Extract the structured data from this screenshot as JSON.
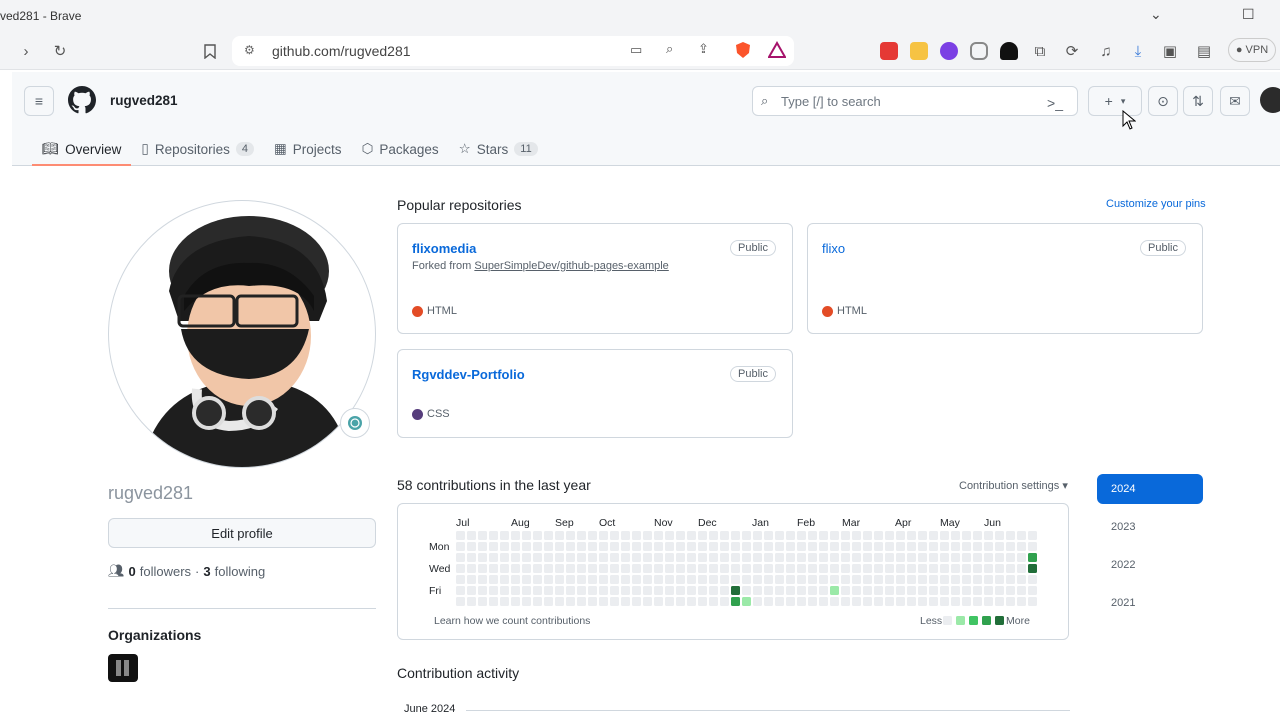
{
  "browser": {
    "title": "ved281 - Brave",
    "url": "github.com/rugved281",
    "vpn_label": "VPN"
  },
  "header": {
    "username": "rugved281",
    "search_placeholder": "Type [/] to search",
    "plus": "+",
    "hamburger": "≡"
  },
  "tabs": [
    {
      "label": "Overview",
      "count": ""
    },
    {
      "label": "Repositories",
      "count": "4"
    },
    {
      "label": "Projects",
      "count": ""
    },
    {
      "label": "Packages",
      "count": ""
    },
    {
      "label": "Stars",
      "count": "11"
    }
  ],
  "profile": {
    "username": "rugved281",
    "edit_label": "Edit profile",
    "followers_count": "0",
    "followers_label": "followers",
    "separator": "·",
    "following_count": "3",
    "following_label": "following",
    "orgs_heading": "Organizations"
  },
  "popular": {
    "heading": "Popular repositories",
    "customize": "Customize your pins",
    "repos": [
      {
        "name": "flixomedia",
        "badge": "Public",
        "forked_prefix": "Forked from",
        "forked_from": "SuperSimpleDev/github-pages-example",
        "language": "HTML",
        "lang_color": "#e34c26"
      },
      {
        "name": "flixo",
        "badge": "Public",
        "language": "HTML",
        "lang_color": "#e34c26"
      },
      {
        "name": "Rgvddev-Portfolio",
        "badge": "Public",
        "language": "CSS",
        "lang_color": "#563d7c"
      }
    ]
  },
  "contributions": {
    "heading": "58 contributions in the last year",
    "settings": "Contribution settings ▾",
    "months": [
      "Jul",
      "Aug",
      "Sep",
      "Oct",
      "Nov",
      "Dec",
      "Jan",
      "Feb",
      "Mar",
      "Apr",
      "May",
      "Jun"
    ],
    "days": [
      "Mon",
      "Wed",
      "Fri"
    ],
    "learn": "Learn how we count contributions",
    "less": "Less",
    "more": "More",
    "levels": [
      "#ebedf0",
      "#9be9a8",
      "#40c463",
      "#30a14e",
      "#216e39"
    ],
    "active_cells": [
      {
        "week": 25,
        "day": 5,
        "level": 4
      },
      {
        "week": 25,
        "day": 6,
        "level": 3
      },
      {
        "week": 26,
        "day": 6,
        "level": 1
      },
      {
        "week": 34,
        "day": 5,
        "level": 1
      },
      {
        "week": 52,
        "day": 2,
        "level": 3
      },
      {
        "week": 52,
        "day": 3,
        "level": 4
      }
    ]
  },
  "years": [
    "2024",
    "2023",
    "2022",
    "2021"
  ],
  "activity": {
    "heading": "Contribution activity",
    "month": "June 2024"
  }
}
